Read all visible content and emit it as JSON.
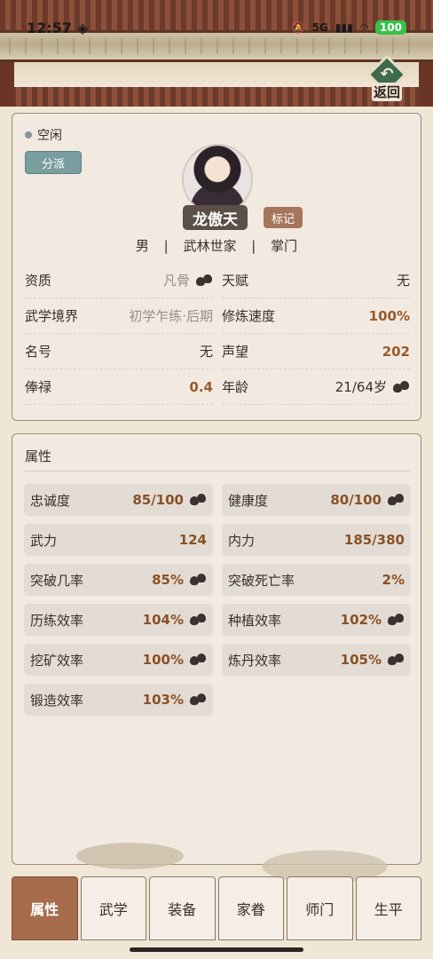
{
  "status_bar": {
    "time": "12:57",
    "network": "5G",
    "battery": "100"
  },
  "header": {
    "back_label": "返回"
  },
  "profile": {
    "state": "空闲",
    "faction_button": "分派",
    "name": "龙傲天",
    "mark_button": "标记",
    "gender": "男",
    "origin": "武林世家",
    "role": "掌门",
    "info": [
      [
        {
          "label": "资质",
          "value": "凡骨",
          "style": "muted",
          "dice": true
        },
        {
          "label": "天赋",
          "value": "无",
          "style": "plain",
          "dice": false
        }
      ],
      [
        {
          "label": "武学境界",
          "value": "初学乍练·后期",
          "style": "muted",
          "dice": false
        },
        {
          "label": "修炼速度",
          "value": "100%",
          "style": "accent",
          "dice": false
        }
      ],
      [
        {
          "label": "名号",
          "value": "无",
          "style": "plain",
          "dice": false
        },
        {
          "label": "声望",
          "value": "202",
          "style": "accent",
          "dice": false
        }
      ],
      [
        {
          "label": "俸禄",
          "value": "0.4",
          "style": "accent",
          "dice": false
        },
        {
          "label": "年龄",
          "value": "21/64岁",
          "style": "plain",
          "dice": true
        }
      ]
    ]
  },
  "attributes": {
    "title": "属性",
    "items": [
      {
        "label": "忠诚度",
        "value": "85/100",
        "dice": true
      },
      {
        "label": "健康度",
        "value": "80/100",
        "dice": true
      },
      {
        "label": "武力",
        "value": "124",
        "dice": false
      },
      {
        "label": "内力",
        "value": "185/380",
        "dice": false
      },
      {
        "label": "突破几率",
        "value": "85%",
        "dice": true
      },
      {
        "label": "突破死亡率",
        "value": "2%",
        "dice": false
      },
      {
        "label": "历练效率",
        "value": "104%",
        "dice": true
      },
      {
        "label": "种植效率",
        "value": "102%",
        "dice": true
      },
      {
        "label": "挖矿效率",
        "value": "100%",
        "dice": true
      },
      {
        "label": "炼丹效率",
        "value": "105%",
        "dice": true
      },
      {
        "label": "锻造效率",
        "value": "103%",
        "dice": true
      }
    ]
  },
  "tabs": [
    {
      "label": "属性",
      "active": true
    },
    {
      "label": "武学",
      "active": false
    },
    {
      "label": "装备",
      "active": false
    },
    {
      "label": "家眷",
      "active": false
    },
    {
      "label": "师门",
      "active": false
    },
    {
      "label": "生平",
      "active": false
    }
  ],
  "colors": {
    "accent": "#a66c4c",
    "faction": "#7a9ea0",
    "value": "#8a5124"
  },
  "icons": {
    "back": "return-arrow-icon",
    "dice": "dice-icon"
  }
}
